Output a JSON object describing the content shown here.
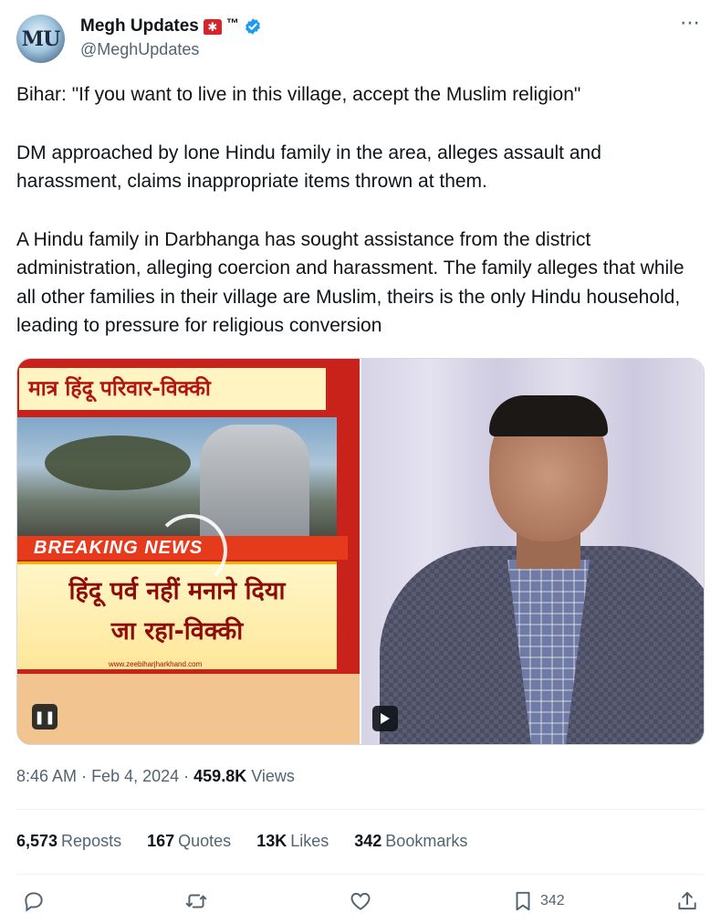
{
  "author": {
    "avatar_text": "MU",
    "name": "Megh Updates",
    "tm": "™",
    "handle": "@MeghUpdates"
  },
  "more_icon": "⋯",
  "tweet": {
    "paragraphs": [
      "Bihar: \"If you want to live in this village, accept the Muslim religion\"",
      "DM approached by lone Hindu family in the area, alleges assault and harassment, claims inappropriate items thrown at them.",
      "A Hindu family in Darbhanga has sought assistance from the district administration, alleging coercion and harassment. The family alleges that while all other families in their village are Muslim, theirs is the only Hindu household, leading to pressure for religious conversion"
    ]
  },
  "media": {
    "left": {
      "top_caption": "मात्र हिंदू परिवार-विक्की",
      "breaking": "BREAKING NEWS",
      "main_caption_line1": "हिंदू पर्व नहीं मनाने दिया",
      "main_caption_line2": "जा रहा-विक्की",
      "website": "www.zeebiharjharkhand.com",
      "control_icon": "pause-icon"
    },
    "right": {
      "control_icon": "play-icon"
    }
  },
  "meta": {
    "time": "8:46 AM",
    "date": "Feb 4, 2024",
    "views_count": "459.8K",
    "views_label": "Views"
  },
  "stats": {
    "reposts_count": "6,573",
    "reposts_label": "Reposts",
    "quotes_count": "167",
    "quotes_label": "Quotes",
    "likes_count": "13K",
    "likes_label": "Likes",
    "bookmarks_count": "342",
    "bookmarks_label": "Bookmarks"
  },
  "actions": {
    "bookmark_count": "342"
  },
  "colors": {
    "text": "#0f1419",
    "secondary": "#536471",
    "verified": "#1d9bf0",
    "divider": "#eff3f4"
  }
}
